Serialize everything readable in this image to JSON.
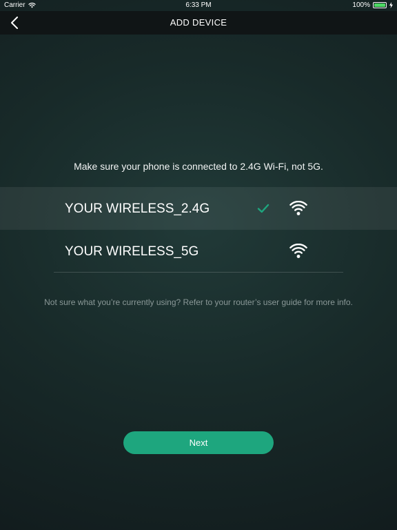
{
  "status_bar": {
    "carrier": "Carrier",
    "time": "6:33 PM",
    "battery_percent": "100%",
    "battery_level": 1.0,
    "wifi_icon": "wifi-icon",
    "charging_icon": "bolt-icon"
  },
  "nav": {
    "title": "ADD DEVICE",
    "back_icon": "chevron-left-icon"
  },
  "instruction": "Make sure your phone is connected to 2.4G Wi-Fi, not 5G.",
  "networks": [
    {
      "name": "YOUR WIRELESS_2.4G",
      "selected": true
    },
    {
      "name": "YOUR WIRELESS_5G",
      "selected": false
    }
  ],
  "hint": "Not sure what you’re currently using? Refer to your router’s user guide for more info.",
  "next_label": "Next",
  "colors": {
    "accent": "#1ea67e",
    "check": "#1ea67e",
    "battery": "#4cd964"
  }
}
